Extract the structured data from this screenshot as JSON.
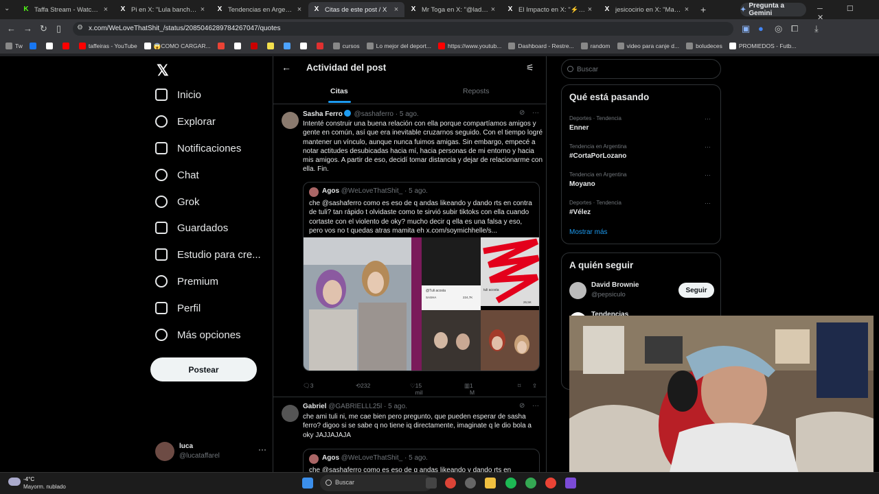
{
  "browser": {
    "tabs": [
      {
        "title": "Taffa Stream - Watch L...",
        "fav": "K",
        "fav_color": "#53fc18",
        "active": false
      },
      {
        "title": "Pi en X: \"Lula banchero nu...",
        "fav": "X",
        "fav_color": "#ffffff",
        "active": false
      },
      {
        "title": "Tendencias en Argentina e...",
        "fav": "X",
        "fav_color": "#ffffff",
        "active": false
      },
      {
        "title": "Citas de este post / X",
        "fav": "X",
        "fav_color": "#ffffff",
        "active": true
      },
      {
        "title": "Mr Toga en X: \"@ladymosi...",
        "fav": "X",
        "fav_color": "#ffffff",
        "active": false
      },
      {
        "title": "El Impacto en X: \"⚡ \"INVI...",
        "fav": "X",
        "fav_color": "#ffffff",
        "active": false
      },
      {
        "title": "jesicocirio en X: \"Martín C...",
        "fav": "X",
        "fav_color": "#ffffff",
        "active": false
      }
    ],
    "new_tab": "+",
    "gemini_label": "Pregunta a Gemini",
    "url": "x.com/WeLoveThatShit_/status/2085046289784267047/quotes",
    "bookmarks": [
      {
        "label": "Tw",
        "color": "#888"
      },
      {
        "label": "",
        "color": "#1877f2"
      },
      {
        "label": "",
        "color": "#ffffff"
      },
      {
        "label": "",
        "color": "#ff0000"
      },
      {
        "label": "taffeiras - YouTube",
        "color": "#ff0000"
      },
      {
        "label": "😱COMO CARGAR...",
        "color": "#ffffff"
      },
      {
        "label": "",
        "color": "#ea4335"
      },
      {
        "label": "",
        "color": "#ffffff"
      },
      {
        "label": "",
        "color": "#cc0000"
      },
      {
        "label": "",
        "color": "#f4e04d"
      },
      {
        "label": "",
        "color": "#4da3ff"
      },
      {
        "label": "",
        "color": "#ffffff"
      },
      {
        "label": "",
        "color": "#e03030"
      },
      {
        "label": "cursos",
        "color": "#888"
      },
      {
        "label": "Lo mejor del deport...",
        "color": "#888"
      },
      {
        "label": "https://www.youtub...",
        "color": "#ff0000"
      },
      {
        "label": "Dashboard - Restre...",
        "color": "#888"
      },
      {
        "label": "random",
        "color": "#888"
      },
      {
        "label": "video para canje d...",
        "color": "#888"
      },
      {
        "label": "boludeces",
        "color": "#888"
      },
      {
        "label": "PROMIEDOS - Futb...",
        "color": "#fff"
      }
    ]
  },
  "nav": {
    "items": [
      "Inicio",
      "Explorar",
      "Notificaciones",
      "Chat",
      "Grok",
      "Guardados",
      "Estudio para cre...",
      "Premium",
      "Perfil",
      "Más opciones"
    ],
    "post_button": "Postear",
    "profile_name": "luca",
    "profile_handle": "@lucataffarel",
    "more": "···"
  },
  "main": {
    "title": "Actividad del post",
    "tabs": [
      "Citas",
      "Reposts"
    ],
    "posts": [
      {
        "name": "Sasha Ferro",
        "handle": "@sashaferro · 5 ago.",
        "text": "Intenté construir una buena relación con ella porque compartíamos amigos y gente en común, así que era inevitable cruzarnos seguido. Con el tiempo logré mantener un vínculo, aunque nunca fuimos amigas. Sin embargo, empecé a notar actitudes desubicadas hacia mí, hacia personas de mi entorno y hacia mis amigos. A partir de eso, decidí tomar distancia y dejar de relacionarme con ella. Fin.",
        "quote": {
          "name": "Agos",
          "handle": "@WeLoveThatShit_ · 5 ago.",
          "text": "che @sashaferro como es eso de q andas likeando y dando rts en contra de tuli? tan rápido t olvidaste como te sirvió subir tiktoks con ella cuando cortaste con el violento de oky? mucho decir q ella es una falsa y eso, pero vos no t quedas atras mamita eh  x.com/soymichhelle/s..."
        },
        "media_labels": [
          "@Tuli acosta",
          "SASHA",
          "224,7K",
          "tuli acosta",
          "26,5K"
        ],
        "actions": {
          "replies": "3",
          "reposts": "232",
          "likes": "15 mil",
          "views": "1 M"
        }
      },
      {
        "name": "Gabriel",
        "handle": "@GABRIELLL25l · 5 ago.",
        "text": "che ami tuli ni, me cae bien pero pregunto, que pueden esperar de sasha ferro? digoo si se sabe q no tiene iq directamente, imaginate q le dio bola a oky JAJJAJAJA",
        "quote": {
          "name": "Agos",
          "handle": "@WeLoveThatShit_ · 5 ago.",
          "text": "che @sashaferro como es eso de q andas likeando y dando rts en"
        }
      }
    ]
  },
  "right": {
    "search_placeholder": "Buscar",
    "trends_title": "Qué está pasando",
    "trends": [
      {
        "category": "Deportes · Tendencia",
        "name": "Enner"
      },
      {
        "category": "Tendencia en Argentina",
        "name": "#CortaPorLozano"
      },
      {
        "category": "Tendencia en Argentina",
        "name": "Moyano"
      },
      {
        "category": "Deportes · Tendencia",
        "name": "#Vélez"
      }
    ],
    "show_more": "Mostrar más",
    "follow_title": "A quién seguir",
    "follow": [
      {
        "name": "David Brownie",
        "handle": "@pepsiculo",
        "button": "Seguir"
      },
      {
        "name": "Tendencias",
        "handle": "",
        "button": ""
      }
    ]
  },
  "taskbar": {
    "temp": "-4°C",
    "weather": "Mayorm. nublado",
    "search": "Buscar"
  }
}
